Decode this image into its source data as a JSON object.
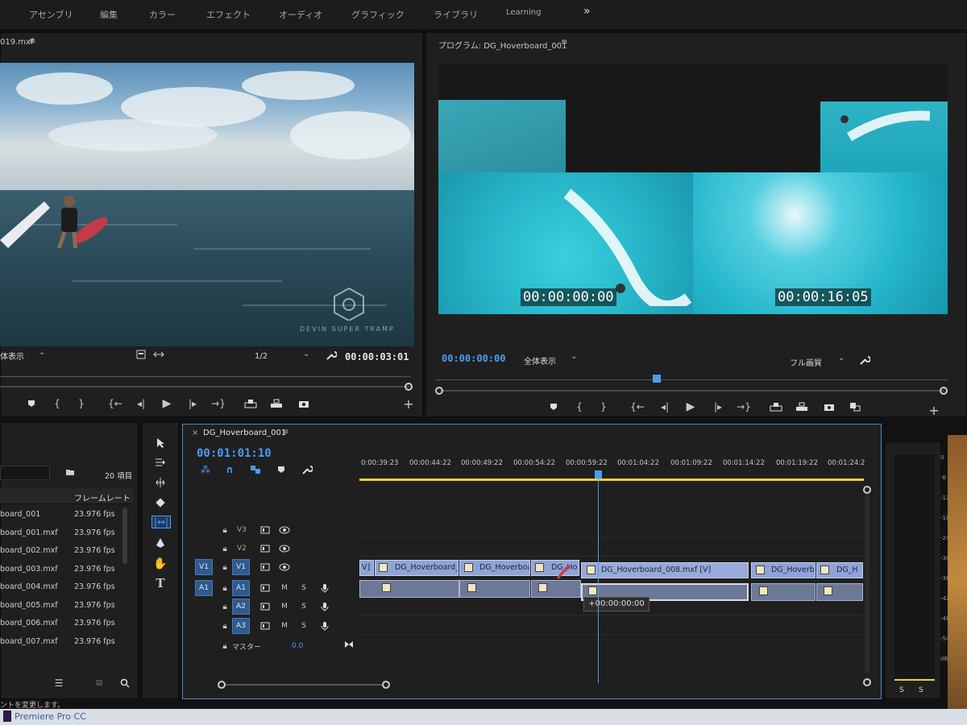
{
  "menu": [
    "アセンブリ",
    "編集",
    "カラー",
    "エフェクト",
    "オーディオ",
    "グラフィック",
    "ライブラリ",
    "Learning"
  ],
  "menu_more": "»",
  "source": {
    "title": "019.mxf",
    "zoom": "体表示",
    "resolution": "1/2",
    "timecode": "00:00:03:01",
    "watermark": "DEVIN SUPER TRAMP"
  },
  "program": {
    "title": "プログラム: DG_Hoverboard_001",
    "timecode": "00:00:00:00",
    "zoom": "全体表示",
    "quality": "フル画質",
    "overlay_left": "00:00:00:00",
    "overlay_right": "00:00:16:05"
  },
  "project": {
    "items_count": "20 項目",
    "column_rate": "フレームレート",
    "rows": [
      {
        "name": "board_001",
        "rate": "23.976 fps"
      },
      {
        "name": "board_001.mxf",
        "rate": "23.976 fps"
      },
      {
        "name": "board_002.mxf",
        "rate": "23.976 fps"
      },
      {
        "name": "board_003.mxf",
        "rate": "23.976 fps"
      },
      {
        "name": "board_004.mxf",
        "rate": "23.976 fps"
      },
      {
        "name": "board_005.mxf",
        "rate": "23.976 fps"
      },
      {
        "name": "board_006.mxf",
        "rate": "23.976 fps"
      },
      {
        "name": "board_007.mxf",
        "rate": "23.976 fps"
      }
    ],
    "status": "ントを変更します。"
  },
  "timeline": {
    "tab": "DG_Hoverboard_001",
    "timecode": "00:01:01:10",
    "ruler": [
      "0:00:39:23",
      "00:00:44:22",
      "00:00:49:22",
      "00:00:54:22",
      "00:00:59:22",
      "00:01:04:22",
      "00:01:09:22",
      "00:01:14:22",
      "00:01:19:22",
      "00:01:24:2"
    ],
    "tracks_video": [
      "V3",
      "V2",
      "V1"
    ],
    "tracks_audio": [
      "A1",
      "A2",
      "A3"
    ],
    "source_v": "V1",
    "source_a": "A1",
    "master_label": "マスター",
    "master_value": "0.0",
    "mute": "M",
    "solo": "S",
    "clips": [
      "V]",
      "DG_Hoverboard_",
      "DG_Hoverboa",
      "DG_Ho",
      "DG_Hoverboard_008.mxf [V]",
      "DG_Hoverb",
      "DG_H"
    ],
    "trim_tooltip": "+00:00:00:00"
  },
  "meter": {
    "scale": [
      "0",
      "-6",
      "-12",
      "-18",
      "-24",
      "-30",
      "-36",
      "-42",
      "-48",
      "-54",
      "dB"
    ],
    "solo_left": "S",
    "solo_right": "S"
  },
  "taskbar": {
    "app": "Premiere Pro CC"
  }
}
